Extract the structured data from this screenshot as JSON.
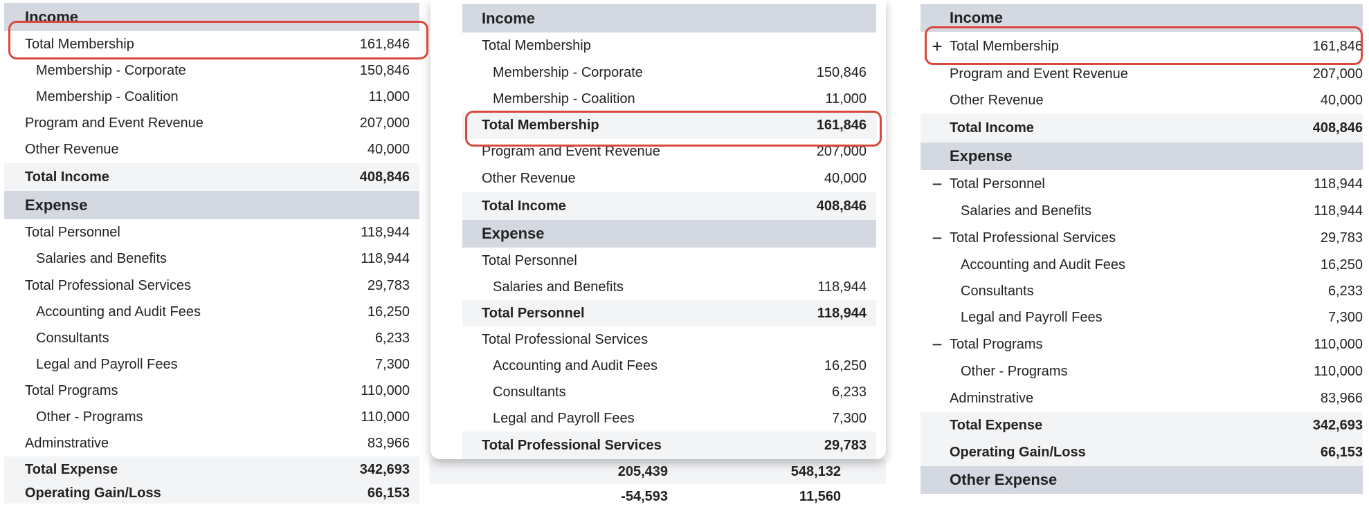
{
  "left_panel": {
    "rows": [
      {
        "label": "Income",
        "value": "",
        "type": "section"
      },
      {
        "label": "Total Membership",
        "value": "161,846",
        "type": "normal"
      },
      {
        "label": "Membership - Corporate",
        "value": "150,846",
        "type": "indent"
      },
      {
        "label": "Membership - Coalition",
        "value": "11,000",
        "type": "indent"
      },
      {
        "label": "Program and Event Revenue",
        "value": "207,000",
        "type": "normal"
      },
      {
        "label": "Other Revenue",
        "value": "40,000",
        "type": "normal"
      },
      {
        "label": "Total Income",
        "value": "408,846",
        "type": "total"
      },
      {
        "label": "Expense",
        "value": "",
        "type": "section"
      },
      {
        "label": "Total Personnel",
        "value": "118,944",
        "type": "normal"
      },
      {
        "label": "Salaries and Benefits",
        "value": "118,944",
        "type": "indent"
      },
      {
        "label": "Total Professional Services",
        "value": "29,783",
        "type": "normal"
      },
      {
        "label": "Accounting and Audit Fees",
        "value": "16,250",
        "type": "indent"
      },
      {
        "label": "Consultants",
        "value": "6,233",
        "type": "indent"
      },
      {
        "label": "Legal and Payroll Fees",
        "value": "7,300",
        "type": "indent"
      },
      {
        "label": "Total Programs",
        "value": "110,000",
        "type": "normal"
      },
      {
        "label": "Other - Programs",
        "value": "110,000",
        "type": "indent"
      },
      {
        "label": "Adminstrative",
        "value": "83,966",
        "type": "normal"
      },
      {
        "label": "Total Expense",
        "value": "342,693",
        "type": "total"
      },
      {
        "label": "Operating Gain/Loss",
        "value": "66,153",
        "type": "total"
      }
    ]
  },
  "middle_panel": {
    "rows": [
      {
        "label": "Income",
        "value": "",
        "type": "section"
      },
      {
        "label": "Total Membership",
        "value": "",
        "type": "normal"
      },
      {
        "label": "Membership - Corporate",
        "value": "150,846",
        "type": "indent"
      },
      {
        "label": "Membership - Coalition",
        "value": "11,000",
        "type": "indent"
      },
      {
        "label": "Total Membership",
        "value": "161,846",
        "type": "total"
      },
      {
        "label": "Program and Event Revenue",
        "value": "207,000",
        "type": "normal"
      },
      {
        "label": "Other Revenue",
        "value": "40,000",
        "type": "normal"
      },
      {
        "label": "Total Income",
        "value": "408,846",
        "type": "total"
      },
      {
        "label": "Expense",
        "value": "",
        "type": "section"
      },
      {
        "label": "Total Personnel",
        "value": "",
        "type": "normal"
      },
      {
        "label": "Salaries and Benefits",
        "value": "118,944",
        "type": "indent"
      },
      {
        "label": "Total Personnel",
        "value": "118,944",
        "type": "total"
      },
      {
        "label": "Total Professional Services",
        "value": "",
        "type": "normal"
      },
      {
        "label": "Accounting and Audit Fees",
        "value": "16,250",
        "type": "indent"
      },
      {
        "label": "Consultants",
        "value": "6,233",
        "type": "indent"
      },
      {
        "label": "Legal and Payroll Fees",
        "value": "7,300",
        "type": "indent"
      },
      {
        "label": "Total Professional Services",
        "value": "29,783",
        "type": "total"
      }
    ],
    "behind_row": [
      "205,439",
      "548,132"
    ],
    "behind_row2": [
      "-54,593",
      "11,560"
    ]
  },
  "right_panel": {
    "rows": [
      {
        "label": "Income",
        "value": "",
        "type": "section",
        "exp": ""
      },
      {
        "label": "Total Membership",
        "value": "161,846",
        "type": "normal",
        "exp": "+"
      },
      {
        "label": "Program and Event Revenue",
        "value": "207,000",
        "type": "normal",
        "exp": ""
      },
      {
        "label": "Other Revenue",
        "value": "40,000",
        "type": "normal",
        "exp": ""
      },
      {
        "label": "Total Income",
        "value": "408,846",
        "type": "total",
        "exp": ""
      },
      {
        "label": "Expense",
        "value": "",
        "type": "section",
        "exp": ""
      },
      {
        "label": "Total Personnel",
        "value": "118,944",
        "type": "normal",
        "exp": "−"
      },
      {
        "label": "Salaries and Benefits",
        "value": "118,944",
        "type": "indent",
        "exp": ""
      },
      {
        "label": "Total Professional Services",
        "value": "29,783",
        "type": "normal",
        "exp": "−"
      },
      {
        "label": "Accounting and Audit Fees",
        "value": "16,250",
        "type": "indent",
        "exp": ""
      },
      {
        "label": "Consultants",
        "value": "6,233",
        "type": "indent",
        "exp": ""
      },
      {
        "label": "Legal and Payroll Fees",
        "value": "7,300",
        "type": "indent",
        "exp": ""
      },
      {
        "label": "Total Programs",
        "value": "110,000",
        "type": "normal",
        "exp": "−"
      },
      {
        "label": "Other - Programs",
        "value": "110,000",
        "type": "indent",
        "exp": ""
      },
      {
        "label": "Adminstrative",
        "value": "83,966",
        "type": "normal",
        "exp": ""
      },
      {
        "label": "Total Expense",
        "value": "342,693",
        "type": "total",
        "exp": ""
      },
      {
        "label": "Operating Gain/Loss",
        "value": "66,153",
        "type": "total",
        "exp": ""
      },
      {
        "label": "Other Expense",
        "value": "",
        "type": "section",
        "exp": ""
      }
    ]
  },
  "colors": {
    "highlight": "#d8483c",
    "section_bg": "#d4d8e1",
    "total_bg": "#f3f4f6"
  }
}
